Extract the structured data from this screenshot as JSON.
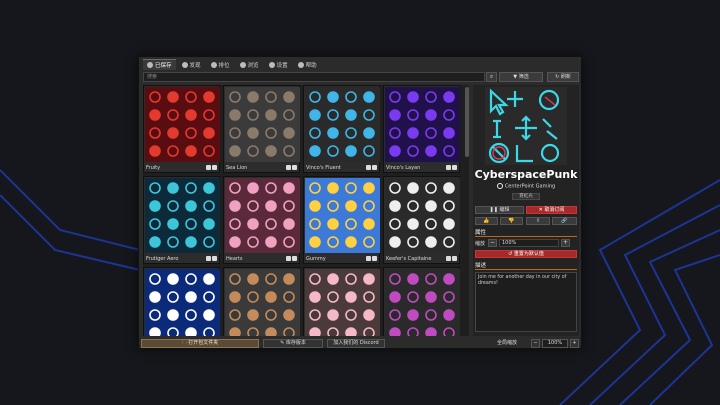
{
  "tabs": [
    {
      "label": "已保存",
      "icon": "save-icon"
    },
    {
      "label": "发现",
      "icon": "compass-icon"
    },
    {
      "label": "排位",
      "icon": "globe-icon"
    },
    {
      "label": "浏览",
      "icon": "browse-icon"
    },
    {
      "label": "设置",
      "icon": "gear-icon"
    },
    {
      "label": "帮助",
      "icon": "help-icon"
    }
  ],
  "search": {
    "placeholder": "搜索",
    "value": ""
  },
  "filter_label": "筛选",
  "refresh_label": "刷新",
  "cards": [
    {
      "name": "Fruity",
      "bg": "#5a0d10",
      "accent": "#e23a2e"
    },
    {
      "name": "Sea Lion",
      "bg": "#3b3b3b",
      "accent": "#8a7a6a"
    },
    {
      "name": "Vinco's Fluent",
      "bg": "#2a2a2a",
      "accent": "#3fb5e8"
    },
    {
      "name": "Vinco's Layan",
      "bg": "#21114a",
      "accent": "#7a3af0"
    },
    {
      "name": "Frutiger Aero",
      "bg": "#0d2a3a",
      "accent": "#3cc6d8"
    },
    {
      "name": "Hearts",
      "bg": "#5a2a3a",
      "accent": "#f0a0c0"
    },
    {
      "name": "Gummy",
      "bg": "#3d7ad8",
      "accent": "#ffd040"
    },
    {
      "name": "Keefer's Capitaine",
      "bg": "#2a2a2a",
      "accent": "#eeeeee"
    },
    {
      "name": "",
      "bg": "#0b2a7a",
      "accent": "#ffffff"
    },
    {
      "name": "",
      "bg": "#3a3a3a",
      "accent": "#c48a5a"
    },
    {
      "name": "",
      "bg": "#4a3a3a",
      "accent": "#f4b8c8"
    },
    {
      "name": "",
      "bg": "#2a2a2a",
      "accent": "#c04ac0"
    }
  ],
  "detail": {
    "title": "CyberspacePunk",
    "author": "CenterPoint Gaming",
    "tag": "霓虹光",
    "edit_label": "编辑",
    "unsave_label": "取消订阅",
    "properties_heading": "属性",
    "size_label": "缩放",
    "size_value": "100%",
    "reset_label": "重置为默认值",
    "description_heading": "描述",
    "description": "Join me for another day in our city of dreams!",
    "accent": "#3cd8e8"
  },
  "bottom": {
    "open_folder_label": "打开包文件夹",
    "create_label": "库存版本",
    "discord_label": "加入我们的 Discord",
    "global_scale_label": "全局缩放",
    "global_scale_value": "100%"
  }
}
